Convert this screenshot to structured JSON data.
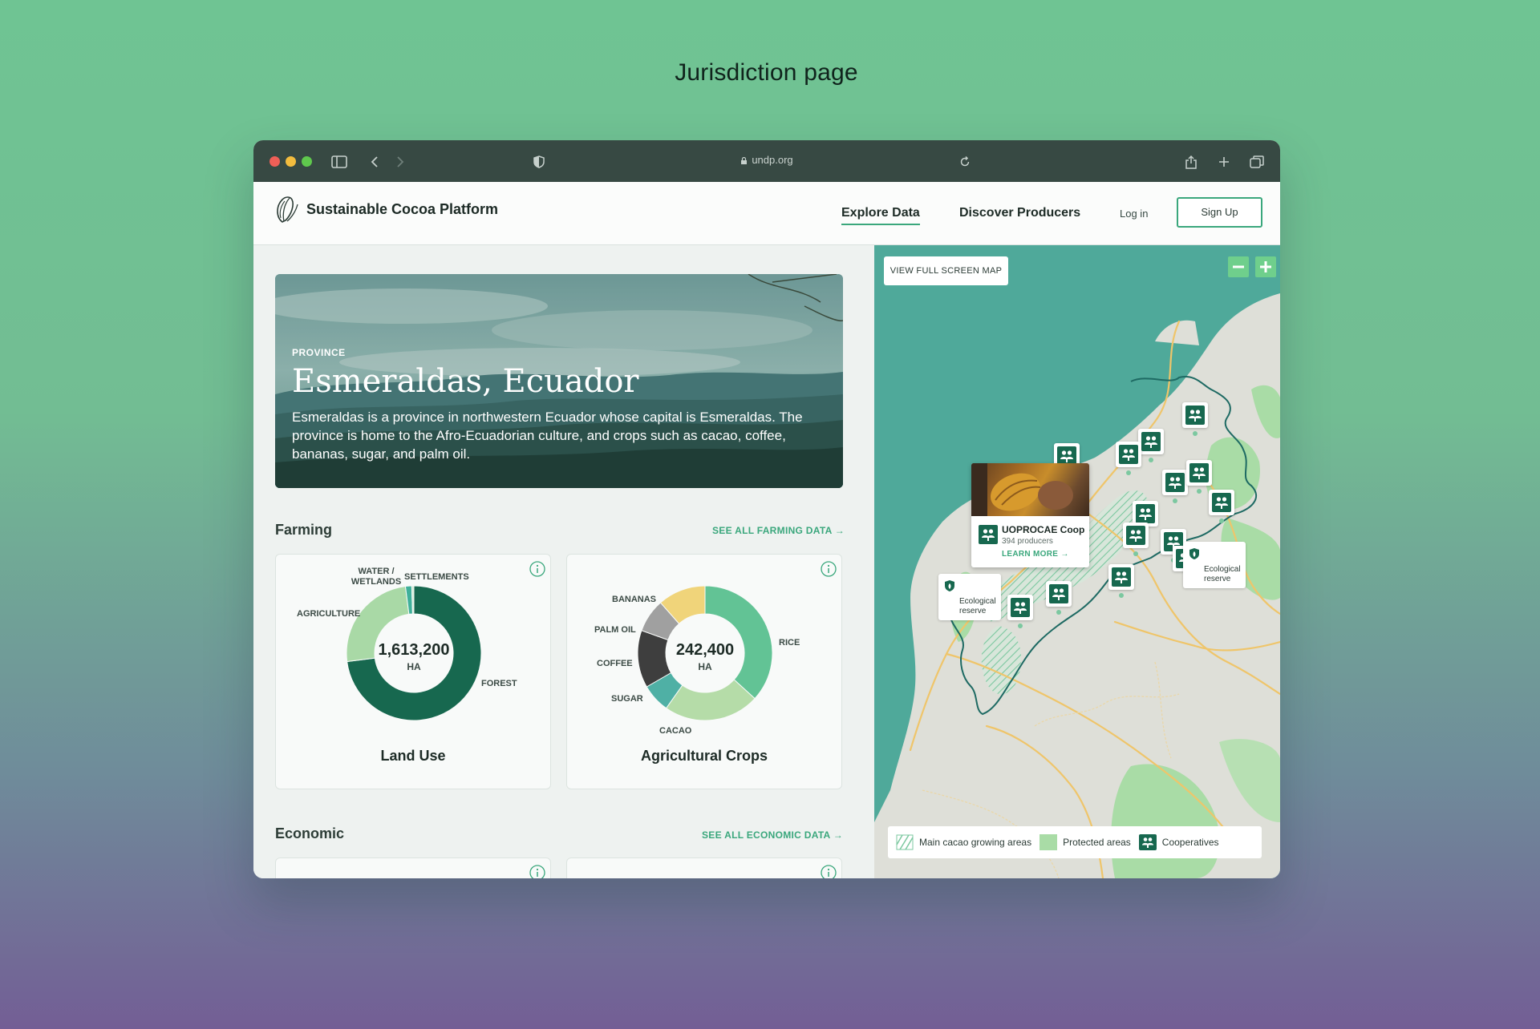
{
  "page_heading": "Jurisdiction page",
  "browser": {
    "url": "undp.org"
  },
  "nav": {
    "brand": "Sustainable Cocoa Platform",
    "links": [
      {
        "label": "Explore Data",
        "active": true
      },
      {
        "label": "Discover Producers",
        "active": false
      }
    ],
    "login": "Log in",
    "signup": "Sign Up"
  },
  "hero": {
    "kicker": "PROVINCE",
    "title": "Esmeraldas, Ecuador",
    "description": "Esmeraldas is a province in northwestern Ecuador whose capital is Esmeraldas. The province is home to the Afro-Ecuadorian culture, and crops such as cacao, coffee, bananas, sugar, and palm oil."
  },
  "farming": {
    "title": "Farming",
    "link": "SEE ALL FARMING DATA",
    "land_use": {
      "title": "Land Use",
      "total": "1,613,200",
      "unit": "HA",
      "labels": {
        "water": "WATER /\nWETLANDS",
        "settlements": "SETTLEMENTS",
        "agriculture": "AGRICULTURE",
        "forest": "FOREST"
      }
    },
    "crops": {
      "title": "Agricultural Crops",
      "total": "242,400",
      "unit": "HA",
      "labels": {
        "bananas": "BANANAS",
        "palm_oil": "PALM OIL",
        "coffee": "COFFEE",
        "sugar": "SUGAR",
        "cacao": "CACAO",
        "rice": "RICE"
      }
    }
  },
  "economic": {
    "title": "Economic",
    "link": "SEE ALL ECONOMIC DATA"
  },
  "map": {
    "fullscreen_label": "VIEW FULL SCREEN MAP",
    "popup": {
      "name": "UOPROCAE Coop",
      "sub": "394 producers",
      "link": "LEARN MORE"
    },
    "reserve_label_1": "Ecological\nreserve",
    "reserve_label_2": "Ecological\nreserve",
    "legend": {
      "cacao": "Main cacao growing areas",
      "protected": "Protected areas",
      "coops": "Cooperatives"
    }
  },
  "chart_data": [
    {
      "type": "pie",
      "title": "Land Use",
      "categories": [
        "FOREST",
        "AGRICULTURE",
        "WATER / WETLANDS",
        "SETTLEMENTS"
      ],
      "values": [
        73,
        25,
        1.5,
        0.5
      ],
      "colors": [
        "#17684f",
        "#a9d9a6",
        "#3fb09a",
        "#cfe9d1"
      ]
    },
    {
      "type": "pie",
      "title": "Agricultural Crops",
      "categories": [
        "RICE",
        "CACAO",
        "SUGAR",
        "COFFEE",
        "PALM OIL",
        "BANANAS"
      ],
      "values": [
        32,
        20,
        6,
        12,
        7,
        10
      ],
      "colors": [
        "#62c395",
        "#b5dca8",
        "#4fb0a5",
        "#3e3e3e",
        "#a0a0a0",
        "#f0d47a"
      ]
    }
  ],
  "colors": {
    "accent": "#3aa77c",
    "brand_dark": "#17684f",
    "map_sea": "#4fa99a"
  }
}
